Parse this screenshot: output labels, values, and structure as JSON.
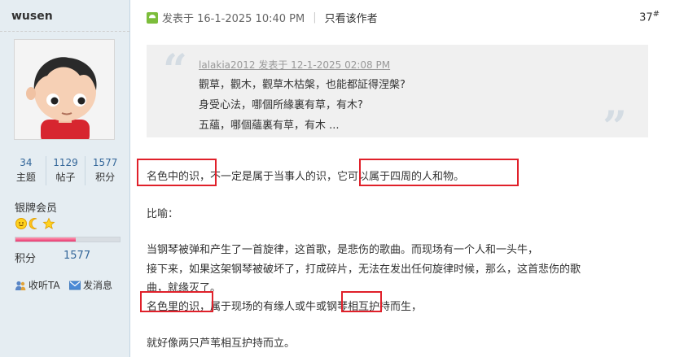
{
  "user": {
    "name": "wusen",
    "stats": [
      {
        "value": "34",
        "label": "主题"
      },
      {
        "value": "1129",
        "label": "帖子"
      },
      {
        "value": "1577",
        "label": "积分"
      }
    ],
    "rank": "银牌会员",
    "medal_icons": [
      "sun-icon",
      "moon-icon",
      "star-icon"
    ],
    "points_label": "积分",
    "points_value": "1577",
    "level_progress": 0.58,
    "follow_label": "收听TA",
    "message_label": "发消息"
  },
  "post": {
    "posted_at": "发表于 16-1-2025 10:40 PM",
    "only_author": "只看该作者",
    "floor": "37",
    "floor_mark": "#",
    "quote": {
      "author_line": "lalakia2012 发表于 12-1-2025 02:08 PM",
      "lines": [
        "觀草，觀木，觀草木枯槃，也能都証得涅槃?",
        "身受心法，哪個所緣裏有草，有木?",
        "五蘊，哪個蘊裏有草，有木 ..."
      ]
    },
    "body": [
      "名色中的识，不一定是属于当事人的识，它可以属于四周的人和物。",
      "比喻：",
      "当钢琴被弹和产生了一首旋律，这首歌，是悲伤的歌曲。而现场有一个人和一头牛，",
      "接下来，如果这架钢琴被破坏了，打成碎片，无法在发出任何旋律时候，那么，这首悲伤的歌",
      "曲，就缘灭了。",
      "名色里的识，属于现场的有缘人或牛或钢琴相互护持而生，",
      "就好像两只芦苇相互护持而立。"
    ]
  },
  "colors": {
    "sidebar_bg": "#e5edf2",
    "highlight": "#e0202a",
    "link": "#336699"
  }
}
